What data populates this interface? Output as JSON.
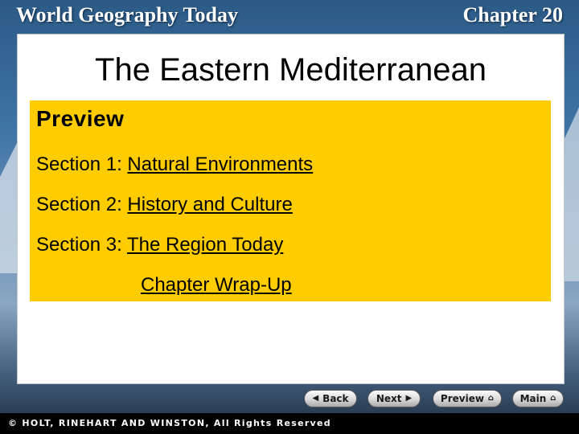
{
  "header": {
    "left": "World Geography Today",
    "right": "Chapter 20"
  },
  "slide": {
    "title": "The Eastern Mediterranean",
    "preview_label": "Preview",
    "sections": [
      {
        "prefix": "Section 1:",
        "link": "Natural Environments"
      },
      {
        "prefix": "Section 2:",
        "link": "History and Culture"
      },
      {
        "prefix": "Section 3:",
        "link": "The Region Today"
      }
    ],
    "wrapup": "Chapter Wrap-Up"
  },
  "nav": {
    "back": "Back",
    "next": "Next",
    "preview": "Preview",
    "main": "Main"
  },
  "footer": {
    "copyright": "© HOLT, RINEHART AND WINSTON, All Rights Reserved"
  },
  "colors": {
    "panel": "#ffcc00",
    "background": "#3f74a6",
    "footer": "#000000"
  }
}
